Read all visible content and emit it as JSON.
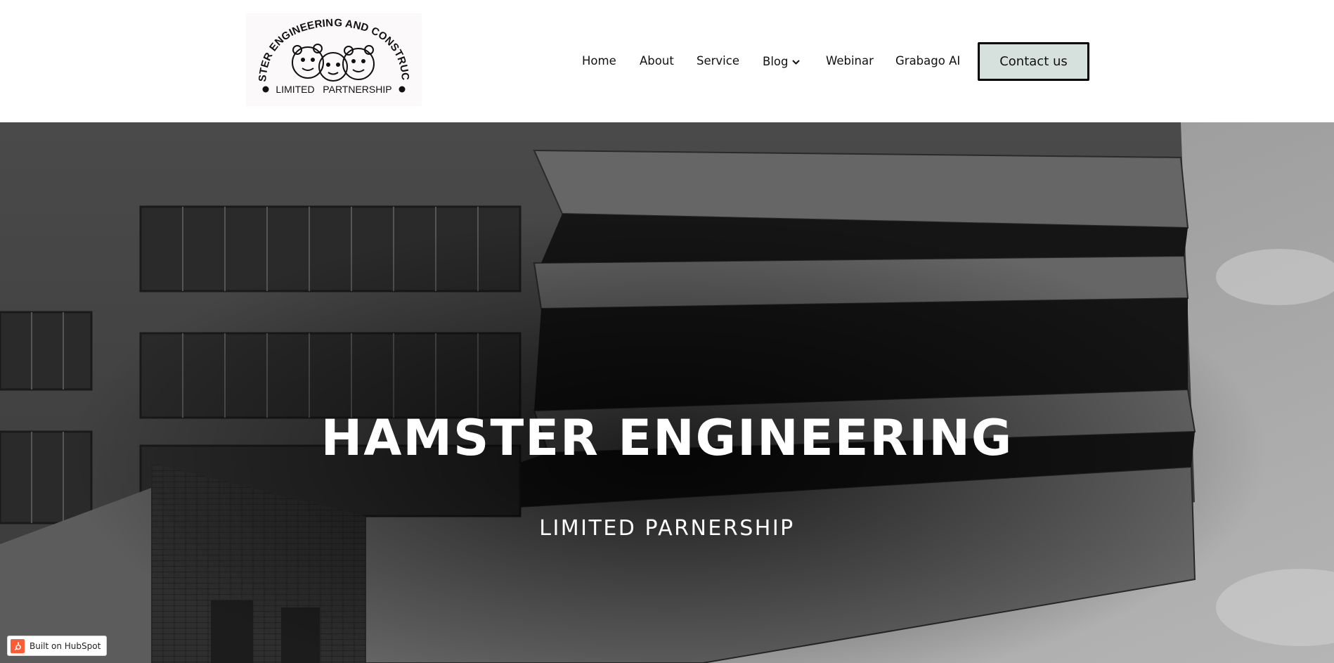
{
  "header": {
    "logo": {
      "arc_text": "HAMSTER ENGINEERING AND CONSTRUCTION",
      "bottom_text": "LIMITED   PARTNERSHIP"
    },
    "nav": {
      "home": "Home",
      "about": "About",
      "service": "Service",
      "blog": "Blog",
      "webinar": "Webinar",
      "grabago": "Grabago AI"
    },
    "contact_label": "Contact us"
  },
  "hero": {
    "title": "HAMSTER ENGINEERING",
    "subtitle": "LIMITED PARNERSHIP"
  },
  "badge": {
    "label": "Built on HubSpot"
  },
  "colors": {
    "contact_bg": "#d6e0dc",
    "hubspot_orange": "#ff5c35",
    "hero_text": "#ffffff"
  },
  "icons": {
    "blog_dropdown": "chevron-down-icon",
    "hubspot": "hubspot-sprocket-icon"
  }
}
